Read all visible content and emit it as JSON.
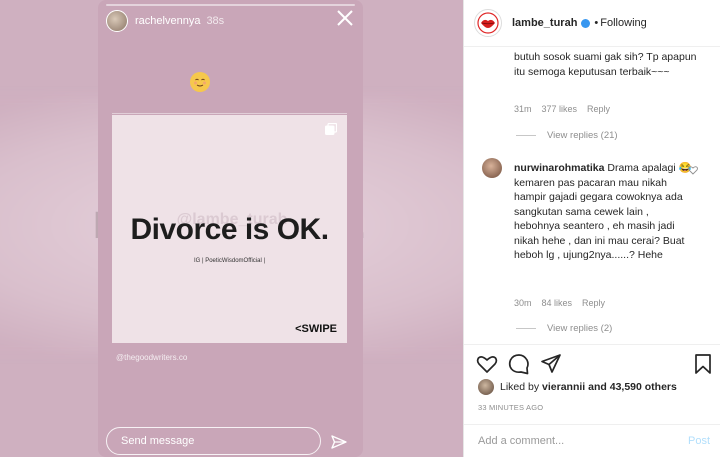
{
  "story": {
    "username": "rachelvennya",
    "time": "38s",
    "emoji_icon": "relieved-face-emoji",
    "card": {
      "watermark": "@lambe_turah",
      "title": "Divorce is OK.",
      "subtitle": "IG | PoeticWisdomOfficial |",
      "swipe": "<SWIPE"
    },
    "credit": "@thegoodwriters.co",
    "message_placeholder": "Send message"
  },
  "post": {
    "header": {
      "username": "lambe_turah",
      "separator": "•",
      "follow_status": "Following"
    },
    "comments": [
      {
        "text": "butuh sosok suami gak sih? Tp apapun itu semoga keputusan terbaik~~~",
        "time": "31m",
        "likes": "377 likes",
        "reply": "Reply",
        "view_replies": "View replies (21)"
      },
      {
        "username": "nurwinarohmatika",
        "text": "Drama apalagi 😂 kemaren pas pacaran mau nikah hampir gajadi gegara cowoknya ada sangkutan sama cewek lain , hebohnya seantero , eh masih jadi nikah hehe , dan ini mau cerai? Buat heboh lg , ujung2nya......? Hehe",
        "time": "30m",
        "likes": "84 likes",
        "reply": "Reply",
        "view_replies": "View replies (2)"
      }
    ],
    "likes": {
      "prefix": "Liked by",
      "user": "vierannii",
      "rest": "and 43,590 others"
    },
    "timestamp": "33 MINUTES AGO",
    "add_comment_placeholder": "Add a comment...",
    "post_button": "Post"
  },
  "colors": {
    "story_bg": "#cfb0c0",
    "card_bg": "#efe2e7",
    "link_blue": "#b2dffc",
    "verified_blue": "#3897f0"
  }
}
